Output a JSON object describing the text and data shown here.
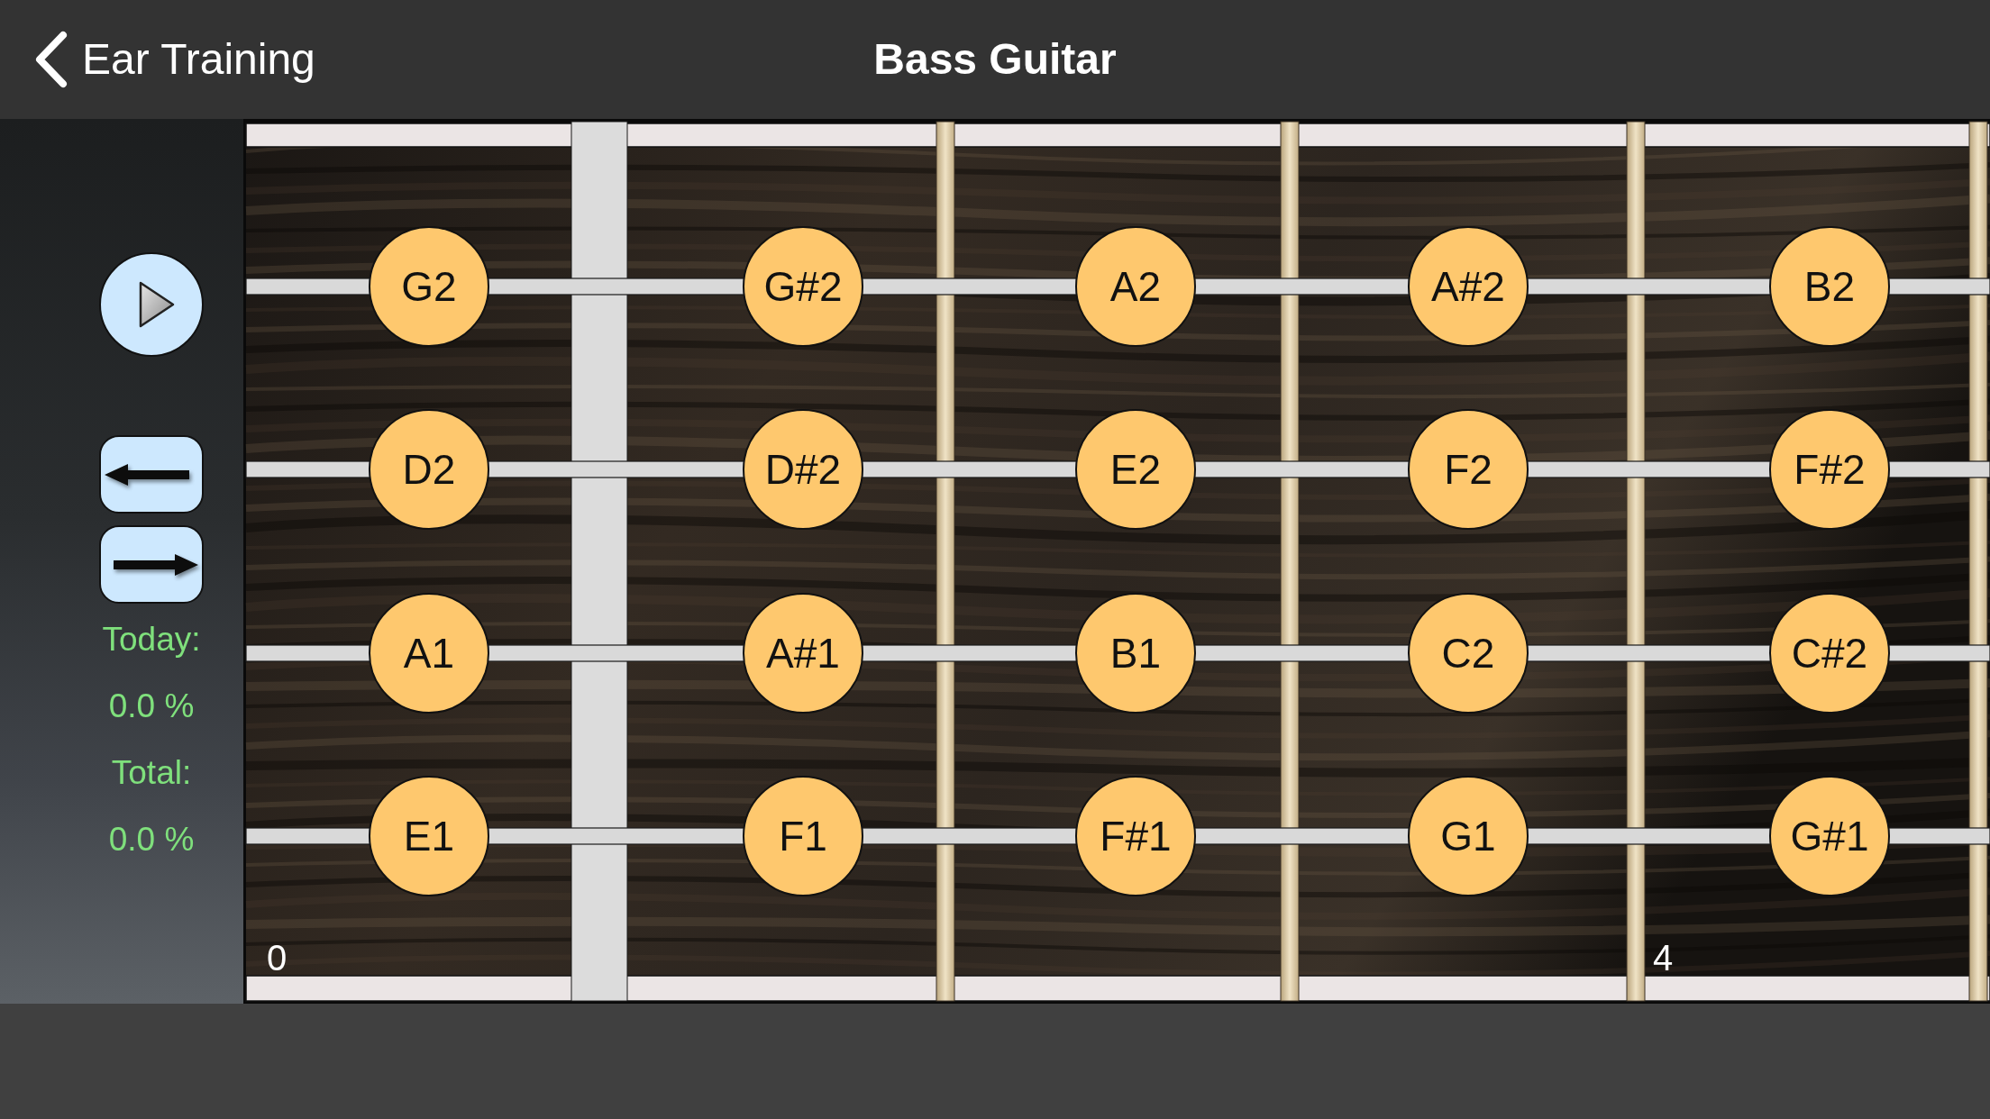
{
  "nav_bar": {
    "back_label": "Ear Training",
    "title": "Bass Guitar"
  },
  "side_panel": {
    "stats": [
      {
        "label": "Today:",
        "value": "0.0 %"
      },
      {
        "label": "Total:",
        "value": "0.0 %"
      }
    ]
  },
  "fretboard": {
    "frets": [
      {
        "marker": "0",
        "notes": [
          "G2",
          "D2",
          "A1",
          "E1"
        ]
      },
      {
        "notes": [
          "G#2",
          "D#2",
          "A#1",
          "F1"
        ]
      },
      {
        "notes": [
          "A2",
          "E2",
          "B1",
          "F#1"
        ]
      },
      {
        "notes": [
          "A#2",
          "F2",
          "C2",
          "G1"
        ]
      },
      {
        "marker": "4",
        "notes": [
          "B2",
          "F#2",
          "C#2",
          "G#1"
        ]
      }
    ]
  }
}
